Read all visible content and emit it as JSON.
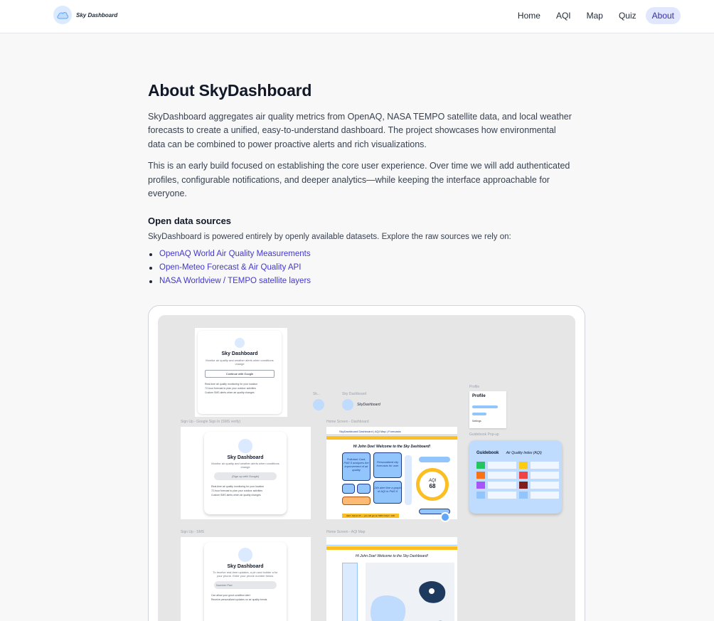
{
  "header": {
    "brand": "Sky Dashboard",
    "nav": [
      {
        "label": "Home"
      },
      {
        "label": "AQI"
      },
      {
        "label": "Map"
      },
      {
        "label": "Quiz"
      },
      {
        "label": "About",
        "active": true
      }
    ]
  },
  "page": {
    "title": "About SkyDashboard",
    "paragraph1": "SkyDashboard aggregates air quality metrics from OpenAQ, NASA TEMPO satellite data, and local weather forecasts to create a unified, easy-to-understand dashboard. The project showcases how environmental data can be combined to power proactive alerts and rich visualizations.",
    "paragraph2": "This is an early build focused on establishing the core user experience. Over time we will add authenticated profiles, configurable notifications, and deeper analytics—while keeping the interface approachable for everyone.",
    "sources_heading": "Open data sources",
    "sources_intro": "SkyDashboard is powered entirely by openly available datasets. Explore the raw sources we rely on:",
    "sources": [
      "OpenAQ World Air Quality Measurements",
      "Open-Meteo Forecast & Air Quality API",
      "NASA Worldview / TEMPO satellite layers"
    ]
  },
  "preview": {
    "signin": {
      "title": "Sky Dashboard",
      "subtitle": "Monitor air quality and weather alerts when conditions change",
      "button": "Continue with Google",
      "bullets": [
        "Real-time air quality monitoring for your location",
        "72-hour forecast to plan your outdoor activities",
        "Custom SMS alerts when air quality changes"
      ]
    },
    "captions": {
      "google": "Sign Up - Google Sign In (SMS verify)",
      "sms": "Sign Up - SMS",
      "sk": "Sk...",
      "skyd": "Sky Dashboard",
      "home": "Home Screen - Dashboard",
      "map": "Home Screen - AQI Map",
      "profile": "Profile",
      "guide": "Guidebook Pop-up"
    },
    "sky_label": "SkyDashboard",
    "google_card": {
      "title": "Sky Dashboard",
      "subtitle": "Monitor air quality and weather alerts when conditions change",
      "button": "(Sign up with Google)",
      "bullets": [
        "Real-time air quality monitoring for your location",
        "72-hour forecast to plan your outdoor activities",
        "Custom SMS alerts when air quality changes"
      ]
    },
    "sms_card": {
      "title": "Sky Dashboard",
      "subtitle": "To receive real-time updates, a pin and builder a for your phone. Enter your phone number below.",
      "input": "Number Pad",
      "bullets": [
        "Can allow your good condition alert",
        "Receive personalized updates on air quality trends"
      ]
    },
    "dashboard": {
      "nav": "SkyDashboard   Dashboard | AQI Map | Forecasts",
      "greeting": "Hi John Doe! Welcome to the Sky Dashboard!",
      "box1": "Pollutant Card, PM2.5 analyzes the improvement of air quality",
      "box2": "Personalized city forecasts for user",
      "box3": "24h alert line a graph of AQI in PM2.5",
      "aqi_label": "AQI",
      "aqi_value": "68",
      "footer": "Alert: AQI at 24 — you will get an SMS if AQI > 100"
    },
    "map_screen": {
      "greeting": "Hi John Doe! Welcome to the Sky Dashboard!"
    },
    "profile": {
      "title": "Profile",
      "settings": "Settings"
    },
    "guide": {
      "title": "Guidebook",
      "subtitle": "Air Quality Index (AQI)"
    }
  }
}
